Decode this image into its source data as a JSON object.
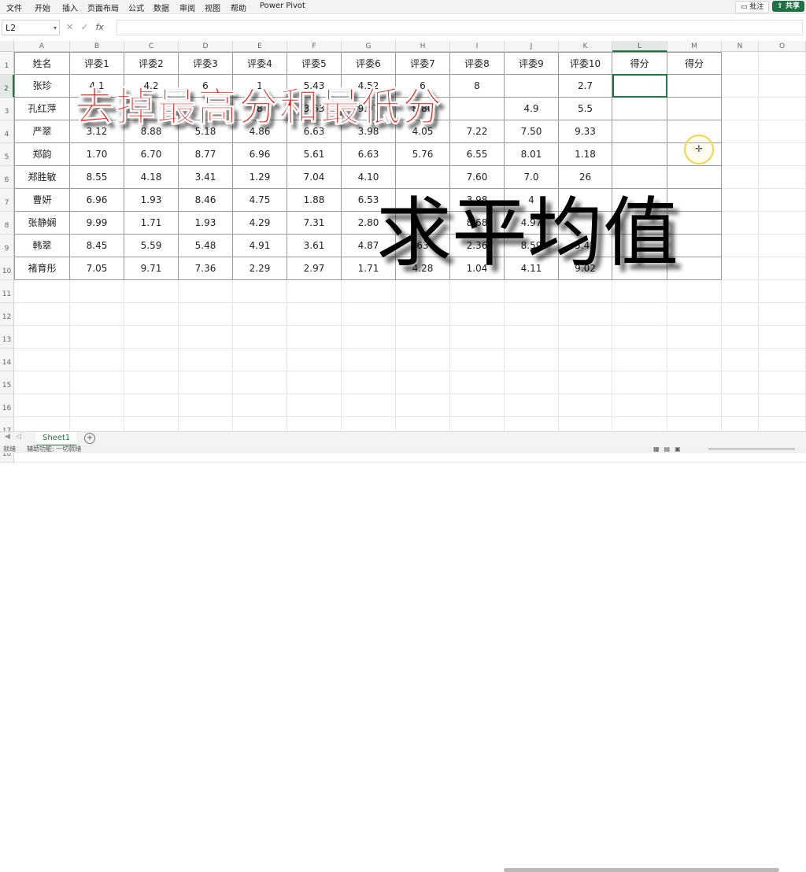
{
  "menu": {
    "items": [
      "文件",
      "开始",
      "插入",
      "页面布局",
      "公式",
      "数据",
      "审阅",
      "视图",
      "帮助",
      "Power Pivot"
    ],
    "note_label": "批注",
    "share_label": "共享"
  },
  "formula_bar": {
    "name_box": "L2",
    "fx_label": "fx",
    "value": ""
  },
  "columns": [
    "A",
    "B",
    "C",
    "D",
    "E",
    "F",
    "G",
    "H",
    "I",
    "J",
    "K",
    "L",
    "M",
    "N",
    "O"
  ],
  "selected_column": "L",
  "rows": [
    "1",
    "2",
    "3",
    "4",
    "5",
    "6",
    "7",
    "8",
    "9",
    "10",
    "11",
    "12",
    "13",
    "14",
    "15",
    "16",
    "17",
    "18"
  ],
  "selected_row": "2",
  "table": {
    "header": [
      "姓名",
      "评委1",
      "评委2",
      "评委3",
      "评委4",
      "评委5",
      "评委6",
      "评委7",
      "评委8",
      "评委9",
      "评委10",
      "得分",
      "得分"
    ],
    "body": [
      [
        "张珍",
        "4.1",
        "4.2",
        "6",
        "1",
        "5.43",
        "4.52",
        "6",
        "8",
        "",
        "2.7",
        "",
        ""
      ],
      [
        "孔红萍",
        "",
        "",
        "",
        "8",
        "3.63",
        "9.97",
        "8.80",
        "",
        "4.9",
        "5.5",
        "",
        ""
      ],
      [
        "严翠",
        "3.12",
        "8.88",
        "5.18",
        "4.86",
        "6.63",
        "3.98",
        "4.05",
        "7.22",
        "7.50",
        "9.33",
        "",
        ""
      ],
      [
        "郑韵",
        "1.70",
        "6.70",
        "8.77",
        "6.96",
        "5.61",
        "6.63",
        "5.76",
        "6.55",
        "8.01",
        "1.18",
        "",
        ""
      ],
      [
        "郑胜敏",
        "8.55",
        "4.18",
        "3.41",
        "1.29",
        "7.04",
        "4.10",
        "",
        "7.60",
        "7.0",
        "26",
        "",
        ""
      ],
      [
        "曹妍",
        "6.96",
        "1.93",
        "8.46",
        "4.75",
        "1.88",
        "6.53",
        "",
        "3.98",
        "4",
        "",
        "",
        ""
      ],
      [
        "张静娴",
        "9.99",
        "1.71",
        "1.93",
        "4.29",
        "7.31",
        "2.80",
        "",
        "8.68",
        "4.97",
        "",
        "",
        ""
      ],
      [
        "韩翠",
        "8.45",
        "5.59",
        "5.48",
        "4.91",
        "3.61",
        "4.87",
        "63",
        "2.36",
        "8.59",
        "5.42",
        "",
        ""
      ],
      [
        "褚育彤",
        "7.05",
        "9.71",
        "7.36",
        "2.29",
        "2.97",
        "1.71",
        "4.28",
        "1.04",
        "4.11",
        "9.02",
        "",
        ""
      ]
    ]
  },
  "overlay": {
    "title_red": "去掉最高分和最低分",
    "title_black": "求平均值"
  },
  "sheet_tabs": [
    {
      "label": "Sheet1"
    }
  ],
  "add_sheet_symbol": "+",
  "status_bar": {
    "left": "就绪",
    "middle": "辅助功能: 一切就绪"
  },
  "colors": {
    "accent": "#217346",
    "overlay_red": "#e8231a",
    "overlay_black": "#000000",
    "cursor_ring": "#f2d448"
  }
}
